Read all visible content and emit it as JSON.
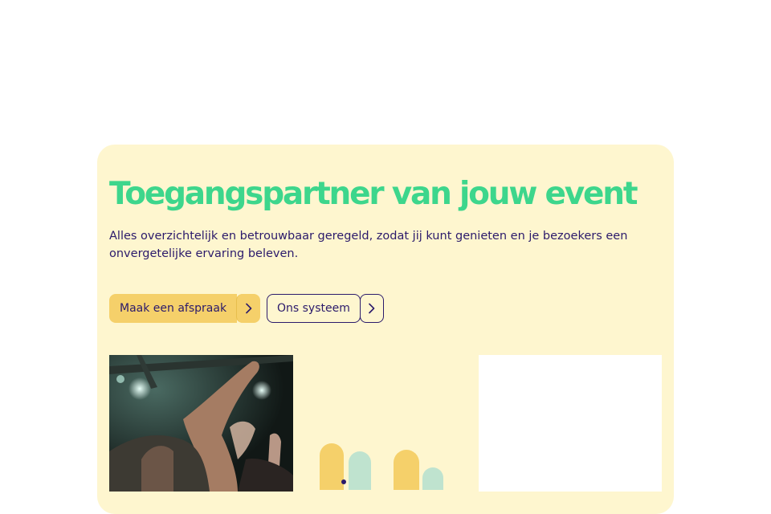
{
  "hero": {
    "title": "Toegangspartner van jouw event",
    "subtitle": "Alles overzichtelijk en betrouwbaar geregeld, zodat jij kunt genieten en je bezoekers een onvergetelijke ervaring beleven."
  },
  "buttons": {
    "primary_label": "Maak een afspraak",
    "secondary_label": "Ons systeem"
  },
  "icons": {
    "primary_arrow": "chevron-right-icon",
    "secondary_arrow": "chevron-right-icon"
  },
  "colors": {
    "card_background": "#fef6cf",
    "title_green": "#3dd68c",
    "text_dark": "#2b1a6b",
    "button_yellow": "#f5d06a"
  }
}
